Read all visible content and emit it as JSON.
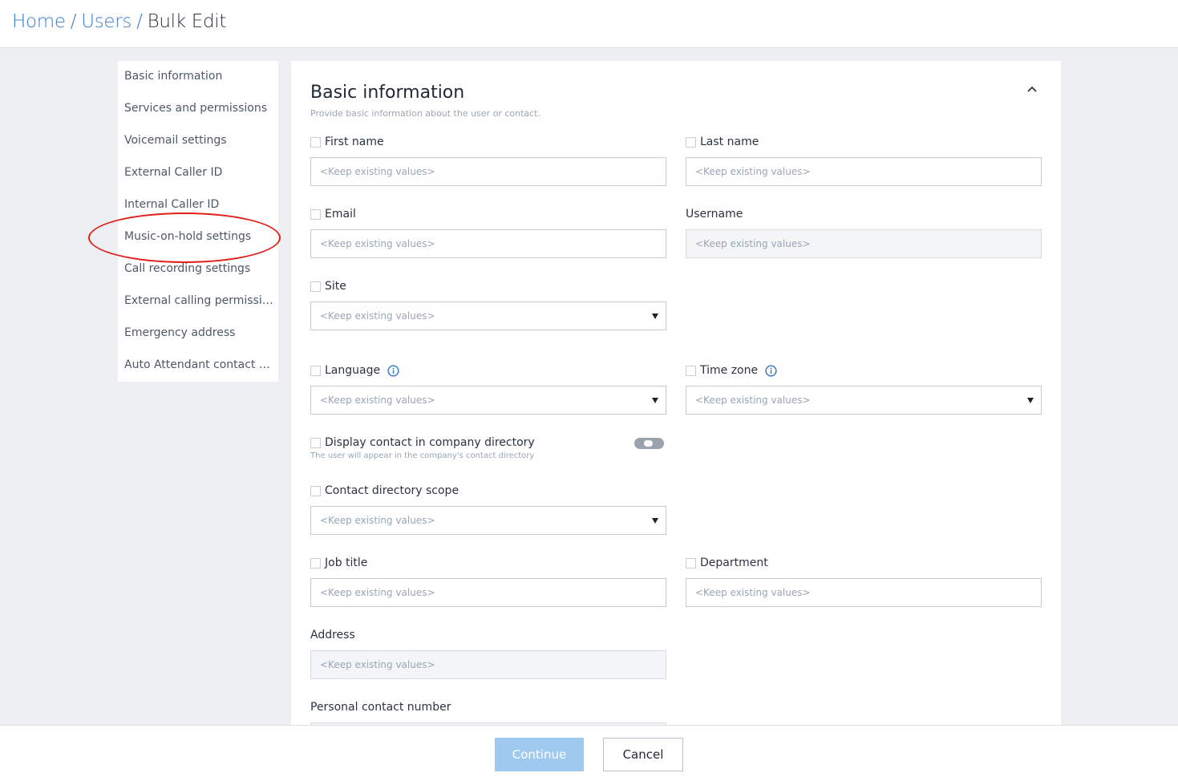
{
  "breadcrumb": {
    "home": "Home",
    "users": "Users",
    "current": "Bulk Edit",
    "separator": "/"
  },
  "sidebar": {
    "items": [
      {
        "label": "Basic information"
      },
      {
        "label": "Services and permissions"
      },
      {
        "label": "Voicemail settings"
      },
      {
        "label": "External Caller ID"
      },
      {
        "label": "Internal Caller ID"
      },
      {
        "label": "Music-on-hold settings"
      },
      {
        "label": "Call recording settings"
      },
      {
        "label": "External calling permission"
      },
      {
        "label": "Emergency address"
      },
      {
        "label": "Auto Attendant contact di..."
      }
    ]
  },
  "panel": {
    "title": "Basic information",
    "subtitle": "Provide basic information about the user or contact.",
    "placeholder": "<Keep existing values>",
    "fields": {
      "first_name": "First name",
      "last_name": "Last name",
      "email": "Email",
      "username": "Username",
      "site": "Site",
      "language": "Language",
      "time_zone": "Time zone",
      "display_contact": "Display contact in company directory",
      "display_contact_hint": "The user will appear in the company's contact directory",
      "contact_scope": "Contact directory scope",
      "job_title": "Job title",
      "department": "Department",
      "address": "Address",
      "personal_number": "Personal contact number"
    }
  },
  "footer": {
    "continue_label": "Continue",
    "cancel_label": "Cancel"
  },
  "colors": {
    "link": "#3b7bcb",
    "annotation": "#e0201b",
    "primary_disabled": "#9fc9ef",
    "info": "#3b7bcb"
  },
  "icons": {
    "collapse": "chevron-up-icon",
    "info": "info-circle-icon",
    "dropdown": "caret-down-icon"
  }
}
